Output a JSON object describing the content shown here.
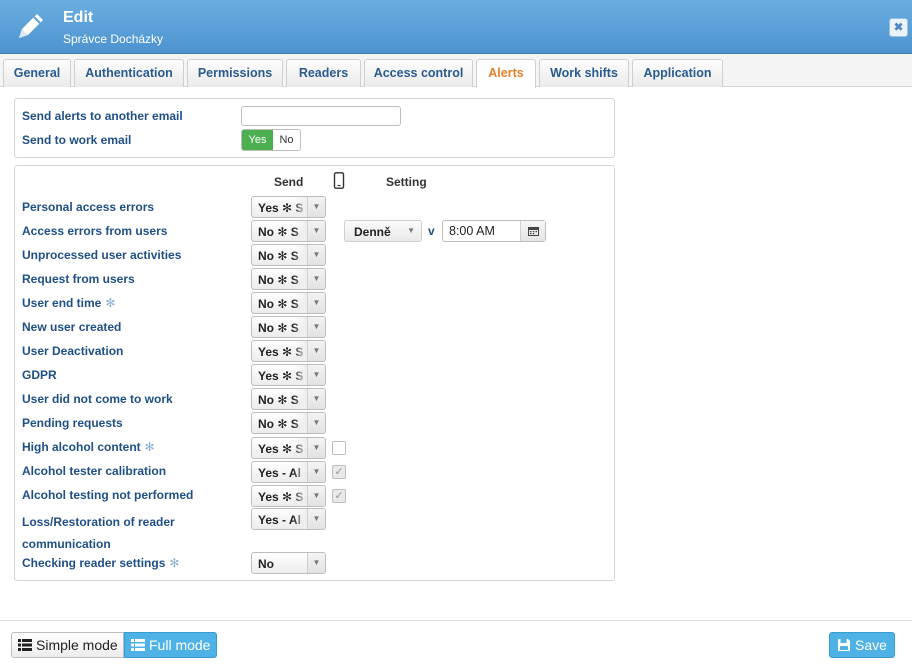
{
  "header": {
    "title": "Edit",
    "subtitle": "Správce Docházky",
    "close_icon": "close-icon"
  },
  "tabs": [
    {
      "label": "General",
      "active": false
    },
    {
      "label": "Authentication",
      "active": false
    },
    {
      "label": "Permissions",
      "active": false
    },
    {
      "label": "Readers",
      "active": false
    },
    {
      "label": "Access control",
      "active": false
    },
    {
      "label": "Alerts",
      "active": true
    },
    {
      "label": "Work shifts",
      "active": false
    },
    {
      "label": "Application",
      "active": false
    }
  ],
  "email": {
    "another_label": "Send alerts to another email",
    "another_value": "",
    "work_label": "Send to work email",
    "yes": "Yes",
    "no": "No",
    "selected": "Yes"
  },
  "columns": {
    "send": "Send",
    "setting": "Setting",
    "mobile_icon": "mobile-phone-icon"
  },
  "alerts": [
    {
      "label": "Personal access errors",
      "value": "Yes ✻ S",
      "starred": false
    },
    {
      "label": "Access errors from users",
      "value": "No ✻ S",
      "starred": false
    },
    {
      "label": "Unprocessed user activities",
      "value": "No ✻ S",
      "starred": false
    },
    {
      "label": "Request from users",
      "value": "No ✻ S",
      "starred": false
    },
    {
      "label": "User end time",
      "value": "No ✻ S",
      "starred": true
    },
    {
      "label": "New user created",
      "value": "No ✻ S",
      "starred": false
    },
    {
      "label": "User Deactivation",
      "value": "Yes ✻ S",
      "starred": false
    },
    {
      "label": "GDPR",
      "value": "Yes ✻ S",
      "starred": false
    },
    {
      "label": "User did not come to work",
      "value": "No ✻ S",
      "starred": false
    },
    {
      "label": "Pending requests",
      "value": "No ✻ S",
      "starred": false
    },
    {
      "label": "High alcohol content",
      "value": "Yes ✻ S",
      "starred": true
    },
    {
      "label": "Alcohol tester calibration",
      "value": "Yes - Al",
      "starred": false
    },
    {
      "label": "Alcohol testing not performed",
      "value": "Yes ✻ S",
      "starred": false
    },
    {
      "label": "Loss/Restoration of reader communication",
      "value": "Yes - Al",
      "starred": false
    },
    {
      "label": "Checking reader settings",
      "value": "No",
      "starred": true
    }
  ],
  "access_errors_setting": {
    "frequency": "Denně",
    "at": "v",
    "time": "8:00 AM"
  },
  "checkboxes": {
    "high_alcohol": false,
    "calibration": true,
    "testing_not_performed": true
  },
  "footer": {
    "simple_mode": "Simple mode",
    "full_mode": "Full mode",
    "save": "Save"
  },
  "colors": {
    "header": "#5a9fd6",
    "active_tab": "#e8802a",
    "label": "#1f4f86",
    "toggle_on": "#4caf50",
    "primary_button": "#4fb2e6"
  }
}
